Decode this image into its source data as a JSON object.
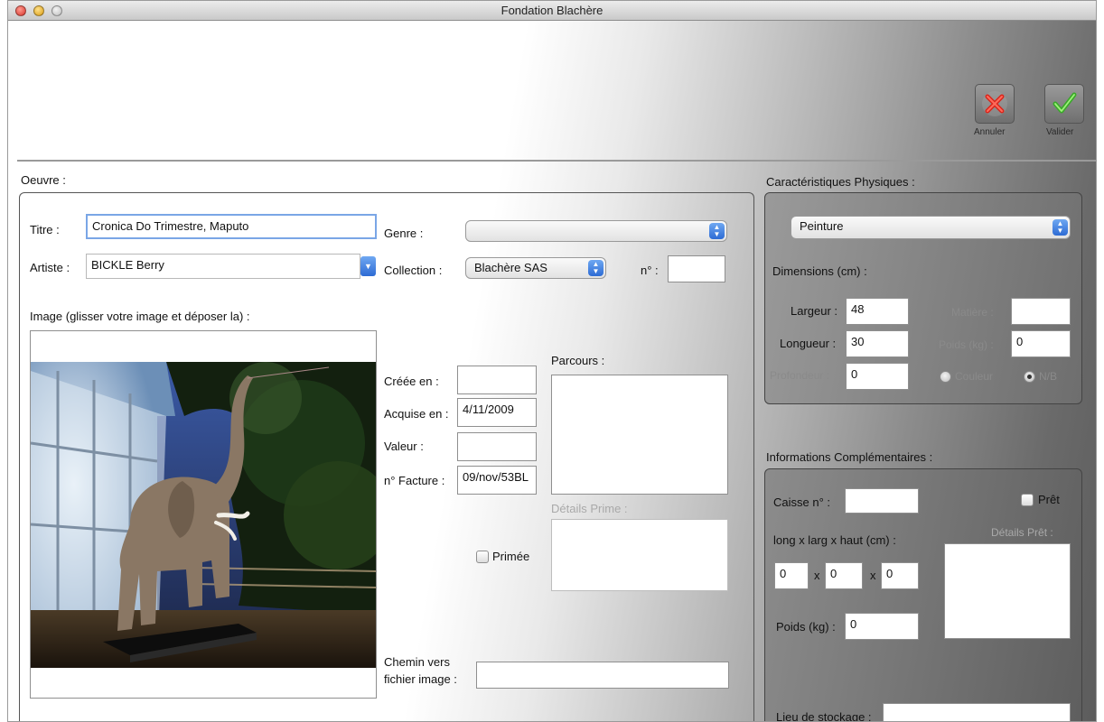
{
  "window": {
    "title": "Fondation Blachère"
  },
  "toolbar": {
    "cancel_label": "Annuler",
    "ok_label": "Valider"
  },
  "oeuvre": {
    "section_label": "Oeuvre :",
    "titre_label": "Titre :",
    "titre_value": "Cronica Do Trimestre, Maputo",
    "artiste_label": "Artiste :",
    "artiste_value": "BICKLE Berry",
    "genre_label": "Genre :",
    "genre_value": "",
    "collection_label": "Collection :",
    "collection_value": "Blachère SAS",
    "numero_label": "n° :",
    "numero_value": "",
    "image_label": "Image (glisser votre image et déposer la) :",
    "image_name_value": "",
    "creee_label": "Créée en :",
    "creee_value": "",
    "acquise_label": "Acquise en :",
    "acquise_value": "4/11/2009",
    "valeur_label": "Valeur :",
    "valeur_value": "",
    "facture_label": "n° Facture :",
    "facture_value": "09/nov/53BL",
    "parcours_label": "Parcours :",
    "parcours_value": "",
    "details_prime_label": "Détails Prime :",
    "primee_label": "Primée",
    "chemin_label_1": "Chemin vers",
    "chemin_label_2": "fichier image :",
    "chemin_value": ""
  },
  "physique": {
    "section_label": "Caractéristiques Physiques :",
    "type_value": "Peinture",
    "dimensions_label": "Dimensions (cm) :",
    "largeur_label": "Largeur :",
    "largeur_value": "48",
    "longueur_label": "Longueur :",
    "longueur_value": "30",
    "profondeur_label": "Profondeur :",
    "profondeur_value": "0",
    "matiere_label": "Matière :",
    "matiere_value": "",
    "poids_label": "Poids (kg) :",
    "poids_value": "0",
    "radio_couleur_label": "Couleur",
    "radio_nb_label": "N/B"
  },
  "complementaires": {
    "section_label": "Informations Complémentaires :",
    "caisse_label": "Caisse n° :",
    "caisse_value": "",
    "pret_label": "Prêt",
    "dims_label": "long x larg x haut (cm) :",
    "long_value": "0",
    "larg_value": "0",
    "haut_value": "0",
    "x_label": "x",
    "details_pret_label": "Détails Prêt :",
    "poids_label": "Poids (kg) :",
    "poids_value": "0",
    "stockage_label": "Lieu de stockage :",
    "stockage_value": ""
  }
}
